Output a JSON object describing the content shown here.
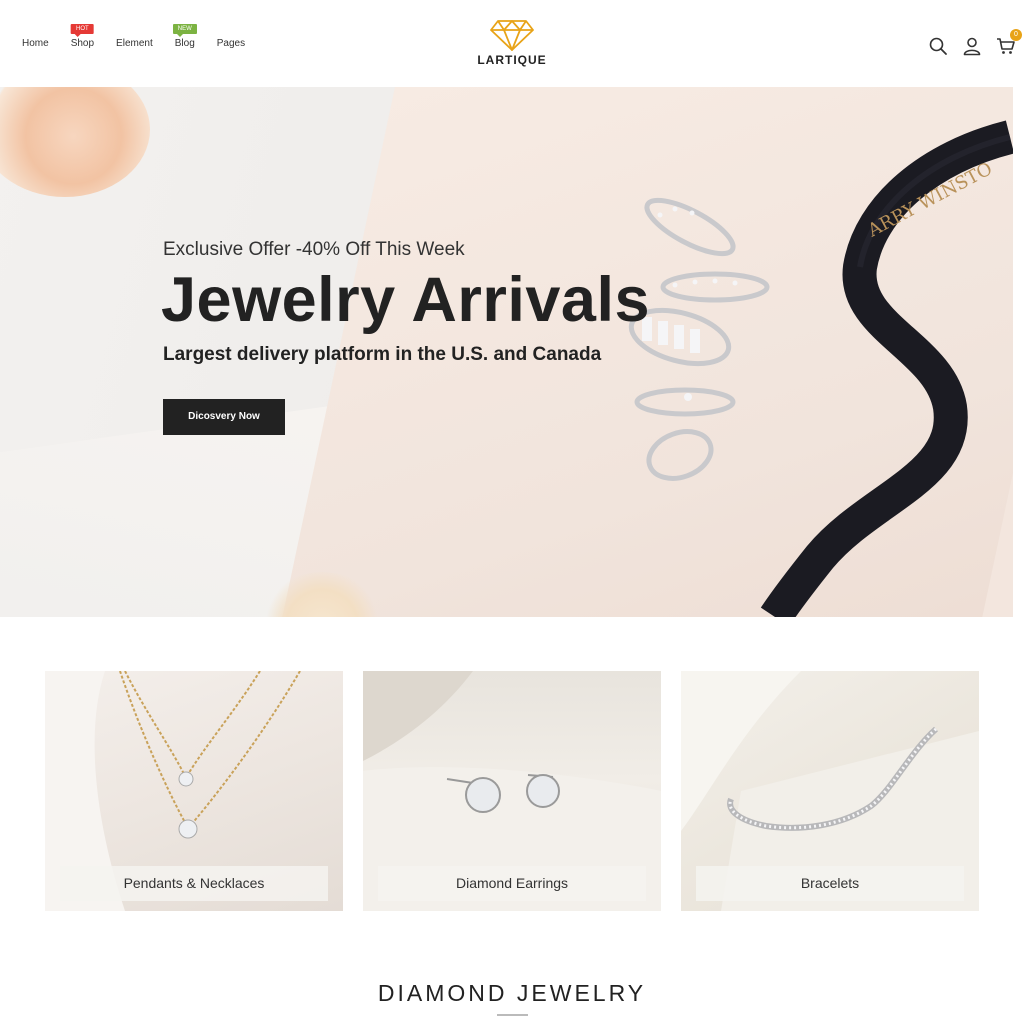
{
  "header": {
    "brand": "LARTIQUE",
    "nav": [
      {
        "label": "Home",
        "badge": ""
      },
      {
        "label": "Shop",
        "badge": "HOT"
      },
      {
        "label": "Element",
        "badge": ""
      },
      {
        "label": "Blog",
        "badge": "NEW"
      },
      {
        "label": "Pages",
        "badge": ""
      }
    ],
    "cart_count": "0",
    "icons": [
      "search-icon",
      "user-icon",
      "cart-icon"
    ]
  },
  "hero": {
    "subtitle": "Exclusive Offer -40% Off This Week",
    "title": "Jewelry Arrivals",
    "tagline": "Largest delivery platform in the U.S. and Canada",
    "button_label": "Dicosvery Now",
    "ribbon_text": "ARRY WINSTO"
  },
  "categories": [
    {
      "label": "Pendants & Necklaces"
    },
    {
      "label": "Diamond Earrings"
    },
    {
      "label": "Bracelets"
    }
  ],
  "section": {
    "title": "DIAMOND JEWELRY"
  },
  "colors": {
    "accent": "#e8a317",
    "hot_badge": "#e53935",
    "new_badge": "#7cb342",
    "button": "#222222"
  }
}
